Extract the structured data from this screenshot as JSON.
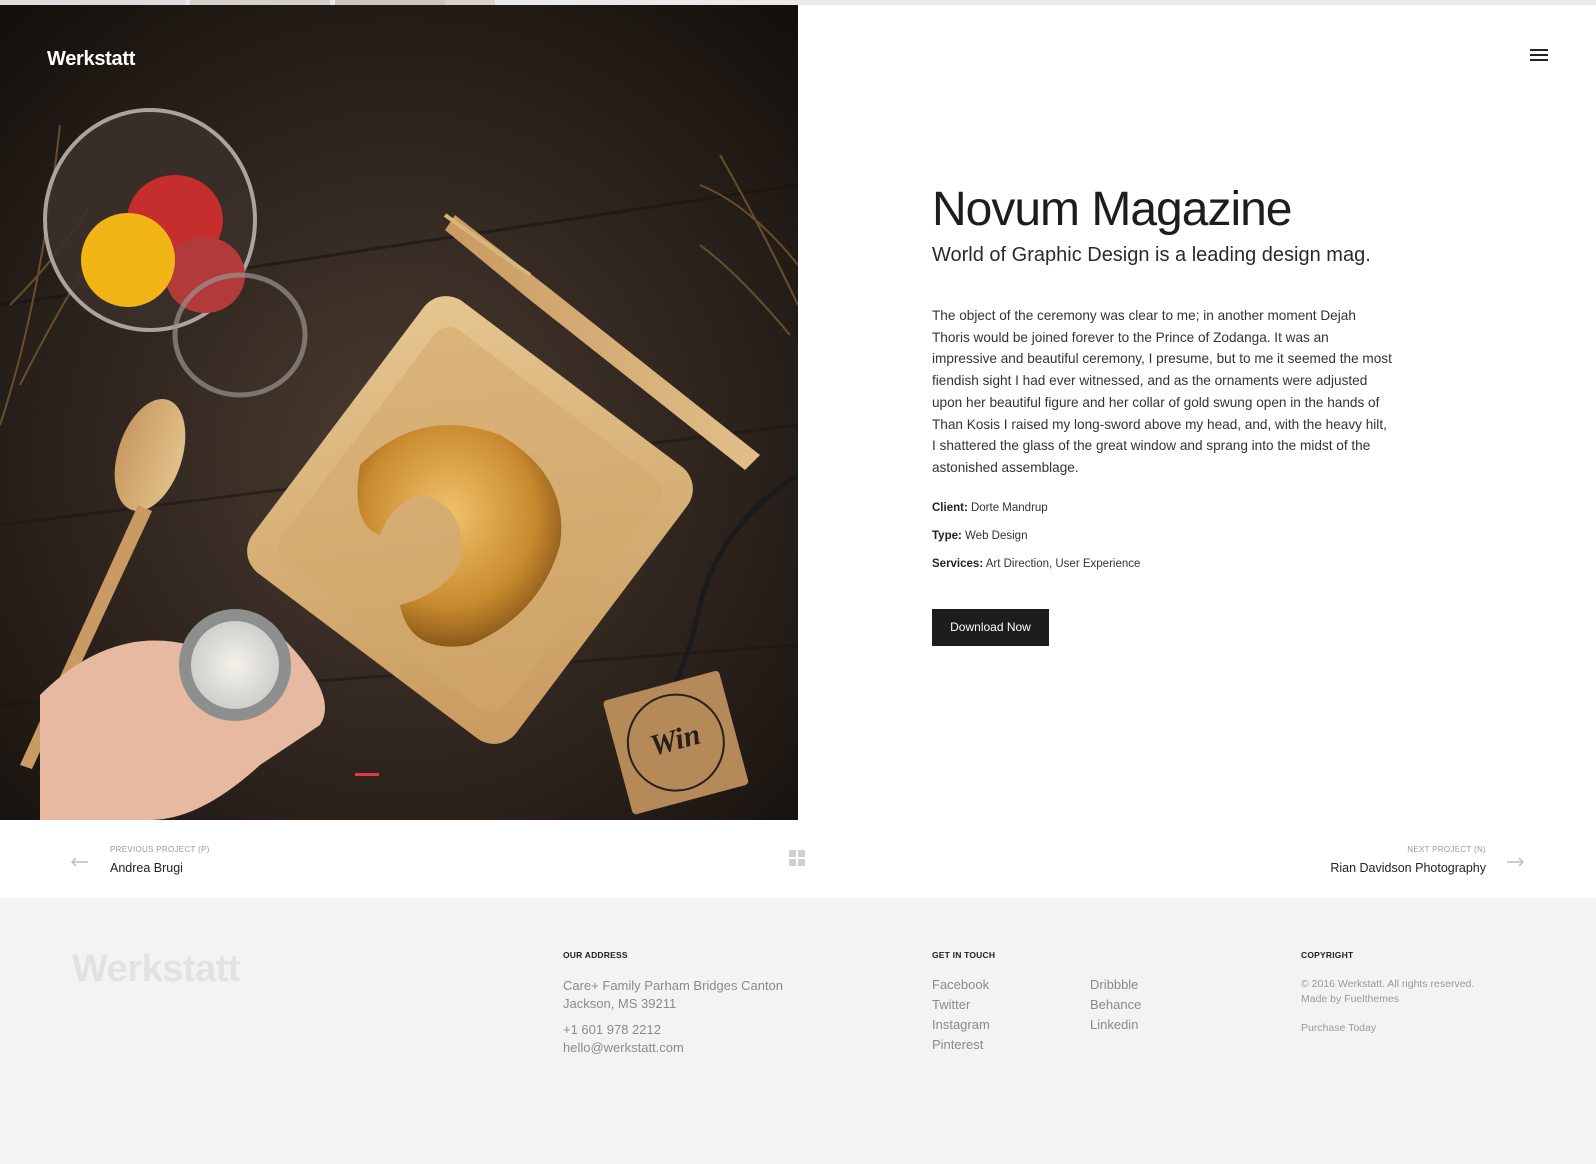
{
  "brand": {
    "logo": "Werkstatt",
    "footer_logo": "Werkstatt"
  },
  "hero": {
    "slide_indicator_color": "#e8334a",
    "image_text": "Win"
  },
  "project": {
    "title": "Novum Magazine",
    "subtitle": "World of Graphic Design is a leading design mag.",
    "description": "The object of the ceremony was clear to me; in another moment Dejah Thoris would be joined forever to the Prince of Zodanga. It was an impressive and beautiful ceremony, I presume, but to me it seemed the most fiendish sight I had ever witnessed, and as the ornaments were adjusted upon her beautiful figure and her collar of gold swung open in the hands of Than Kosis I raised my long-sword above my head, and, with the heavy hilt, I shattered the glass of the great window and sprang into the midst of the astonished assemblage.",
    "client_label": "Client:",
    "client_value": "Dorte Mandrup",
    "type_label": "Type:",
    "type_value": "Web Design",
    "services_label": "Services:",
    "services_value": "Art Direction, User Experience",
    "download_label": "Download Now"
  },
  "project_nav": {
    "prev_small": "PREVIOUS PROJECT (P)",
    "prev_name": "Andrea Brugi",
    "next_small": "NEXT PROJECT (N)",
    "next_name": "Rian Davidson Photography"
  },
  "footer": {
    "address_head": "OUR ADDRESS",
    "address_line1": "Care+ Family Parham Bridges Canton",
    "address_line2": "Jackson, MS 39211",
    "phone": "+1 601 978 2212",
    "email": "hello@werkstatt.com",
    "touch_head": "GET IN TOUCH",
    "social_col1": [
      "Facebook",
      "Twitter",
      "Instagram",
      "Pinterest"
    ],
    "social_col2": [
      "Dribbble",
      "Behance",
      "Linkedin"
    ],
    "copyright_head": "COPYRIGHT",
    "copyright_line1": "© 2016 Werkstatt. All rights reserved.",
    "copyright_line2": "Made by Fuelthemes",
    "purchase": "Purchase Today"
  }
}
